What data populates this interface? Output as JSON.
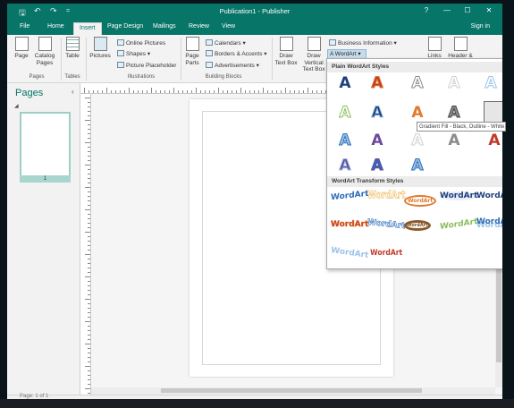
{
  "window": {
    "title": "Publication1 - Publisher",
    "help_glyph": "?",
    "minimize_glyph": "—",
    "restore_glyph": "☐",
    "close_glyph": "✕",
    "accent": "#077568"
  },
  "quick_access": {
    "save_icon": "save-icon",
    "undo_icon": "undo-icon",
    "redo_icon": "redo-icon",
    "save_glyph": "🖫",
    "undo_glyph": "↶",
    "redo_glyph": "↷",
    "customize_glyph": "="
  },
  "tabs": {
    "file": "File",
    "home": "Home",
    "insert": "Insert",
    "page_design": "Page Design",
    "mailings": "Mailings",
    "review": "Review",
    "view": "View",
    "sign_in": "Sign in"
  },
  "ribbon": {
    "page": "Page",
    "catalog_pages": "Catalog Pages",
    "table": "Table",
    "pictures": "Pictures",
    "online_pictures": "Online Pictures",
    "shapes": "Shapes",
    "picture_placeholder": "Picture Placeholder",
    "page_parts": "Page Parts",
    "calendars": "Calendars",
    "borders_accents": "Borders & Accents",
    "advertisements": "Advertisements",
    "draw_text_box": "Draw Text Box",
    "draw_vertical_text_box": "Draw Vertical Text Box",
    "business_information": "Business Information",
    "wordart": "WordArt",
    "links": "Links",
    "header_footer": "Header &",
    "groups": {
      "pages": "Pages",
      "tables": "Tables",
      "illustrations": "Illustrations",
      "building_blocks": "Building Blocks"
    }
  },
  "pages_pane": {
    "title": "Pages",
    "page_number": "1"
  },
  "gallery": {
    "plain_heading": "Plain WordArt Styles",
    "transform_heading": "WordArt Transform Styles",
    "glyph": "A",
    "transform_text": "WordArt",
    "tooltip": "Gradient Fill - Black, Outline - White",
    "colors": {
      "blue": "#2b6cb8",
      "orange": "#e07a2e",
      "gray": "#8c8c8c",
      "lightblue": "#9cc3e6",
      "purple": "#6a4a9c",
      "red": "#c0392b",
      "silver": "#d0d0d0",
      "navy": "#1f3f7a",
      "green": "#8bbd5a",
      "tan": "#f0c070"
    }
  },
  "status": {
    "page": "Page: 1 of 1"
  }
}
